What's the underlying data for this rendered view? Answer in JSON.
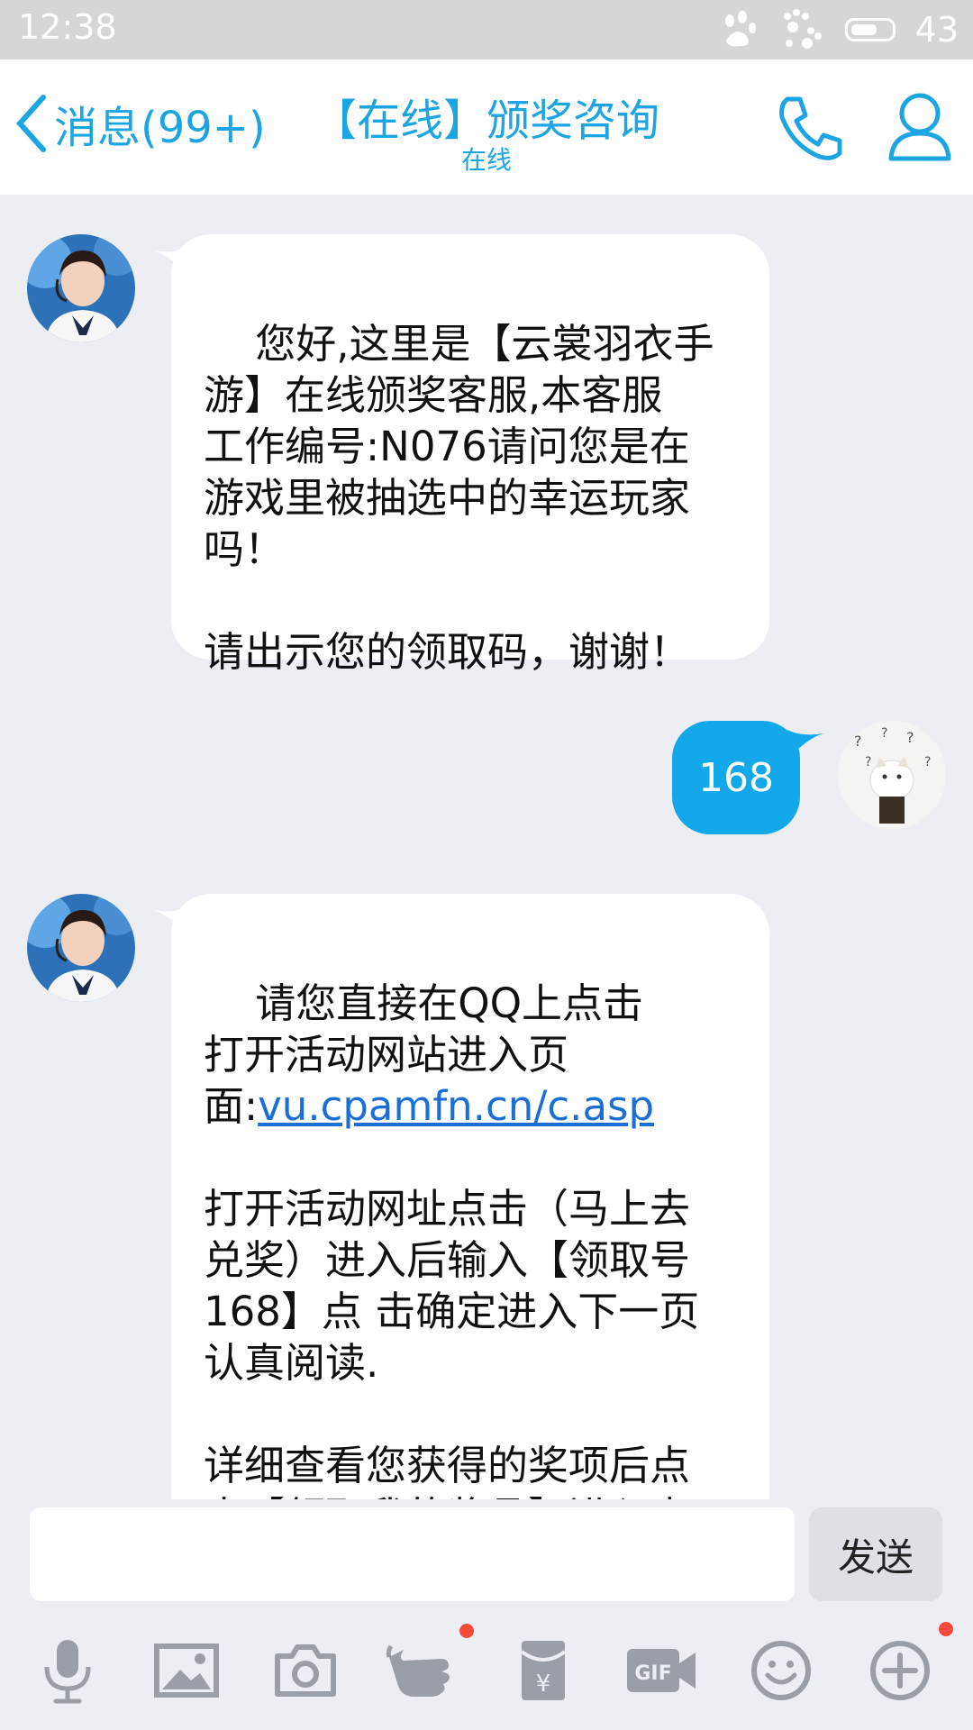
{
  "status_bar": {
    "time": "12:38",
    "battery_level": "43"
  },
  "nav": {
    "back_label": "消息(99+)",
    "title": "【在线】颁奖咨询",
    "subtitle": "在线"
  },
  "messages": [
    {
      "direction": "incoming",
      "text": "您好,这里是【云裳羽衣手\n游】在线颁奖客服,本客服\n工作编号:N076请问您是在\n游戏里被抽选中的幸运玩家\n吗！\n\n请出示您的领取码，谢谢！"
    },
    {
      "direction": "outgoing",
      "text": "168"
    },
    {
      "direction": "incoming",
      "text_before_link": "请您直接在QQ上点击\n打开活动网站进入页\n面:",
      "link": "vu.cpamfn.cn/c.asp",
      "text_after_link": "\n\n打开活动网址点击（马上去\n兑奖）进入后输入【领取号\n168】点 击确定进入下一页\n认真阅读.\n\n详细查看您获得的奖项后点\n击【领取我的奖品】进入查"
    }
  ],
  "input": {
    "value": "",
    "send_label": "发送"
  },
  "toolbar": {
    "icons": [
      "microphone-icon",
      "image-icon",
      "camera-icon",
      "poke-icon",
      "red-packet-icon",
      "gif-icon",
      "emoji-icon",
      "plus-icon"
    ]
  },
  "colors": {
    "accent": "#1ba5e3",
    "outgoing_bubble": "#12a8ea",
    "background": "#eceef4",
    "badge": "#f24a3b"
  }
}
